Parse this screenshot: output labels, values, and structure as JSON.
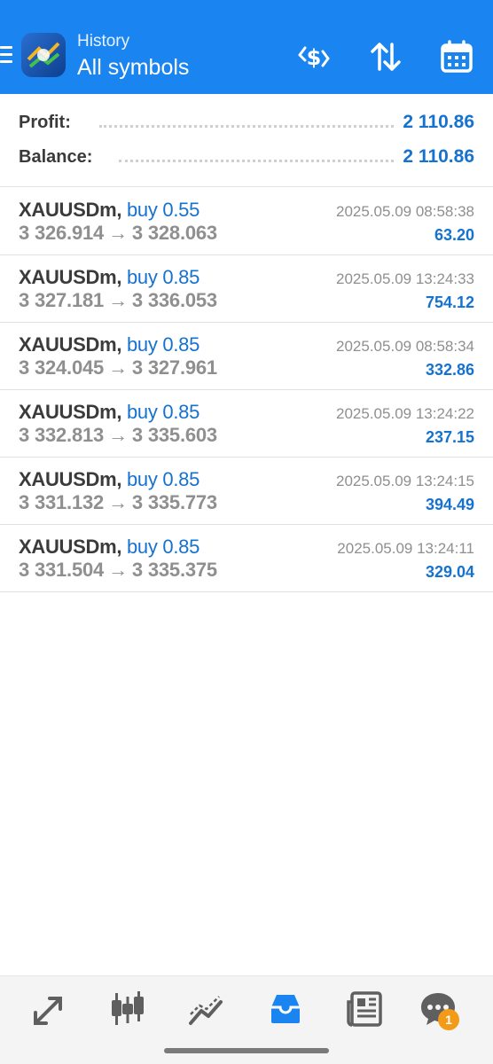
{
  "header": {
    "title": "History",
    "subtitle": "All symbols",
    "colors": {
      "background": "#1a84f0"
    },
    "icons": [
      "menu-icon",
      "app-logo",
      "profit-filter-icon",
      "sort-icon",
      "calendar-icon"
    ]
  },
  "summary": {
    "profit_label": "Profit:",
    "profit_value": "2 110.86",
    "balance_label": "Balance:",
    "balance_value": "2 110.86"
  },
  "trades": [
    {
      "symbol": "XAUUSDm,",
      "side": "buy 0.55",
      "open_price": "3 326.914",
      "arrow": "→",
      "close_price": "3 328.063",
      "time": "2025.05.09 08:58:38",
      "profit": "63.20"
    },
    {
      "symbol": "XAUUSDm,",
      "side": "buy 0.85",
      "open_price": "3 327.181",
      "arrow": "→",
      "close_price": "3 336.053",
      "time": "2025.05.09 13:24:33",
      "profit": "754.12"
    },
    {
      "symbol": "XAUUSDm,",
      "side": "buy 0.85",
      "open_price": "3 324.045",
      "arrow": "→",
      "close_price": "3 327.961",
      "time": "2025.05.09 08:58:34",
      "profit": "332.86"
    },
    {
      "symbol": "XAUUSDm,",
      "side": "buy 0.85",
      "open_price": "3 332.813",
      "arrow": "→",
      "close_price": "3 335.603",
      "time": "2025.05.09 13:24:22",
      "profit": "237.15"
    },
    {
      "symbol": "XAUUSDm,",
      "side": "buy 0.85",
      "open_price": "3 331.132",
      "arrow": "→",
      "close_price": "3 335.773",
      "time": "2025.05.09 13:24:15",
      "profit": "394.49"
    },
    {
      "symbol": "XAUUSDm,",
      "side": "buy 0.85",
      "open_price": "3 331.504",
      "arrow": "→",
      "close_price": "3 335.375",
      "time": "2025.05.09 13:24:11",
      "profit": "329.04"
    }
  ],
  "bottom_nav": {
    "items": [
      "trade-icon",
      "quotes-icon",
      "chart-icon",
      "history-icon",
      "news-icon",
      "messages-icon"
    ],
    "active": "history-icon",
    "active_color": "#1a84f0",
    "messages_badge": "1"
  }
}
